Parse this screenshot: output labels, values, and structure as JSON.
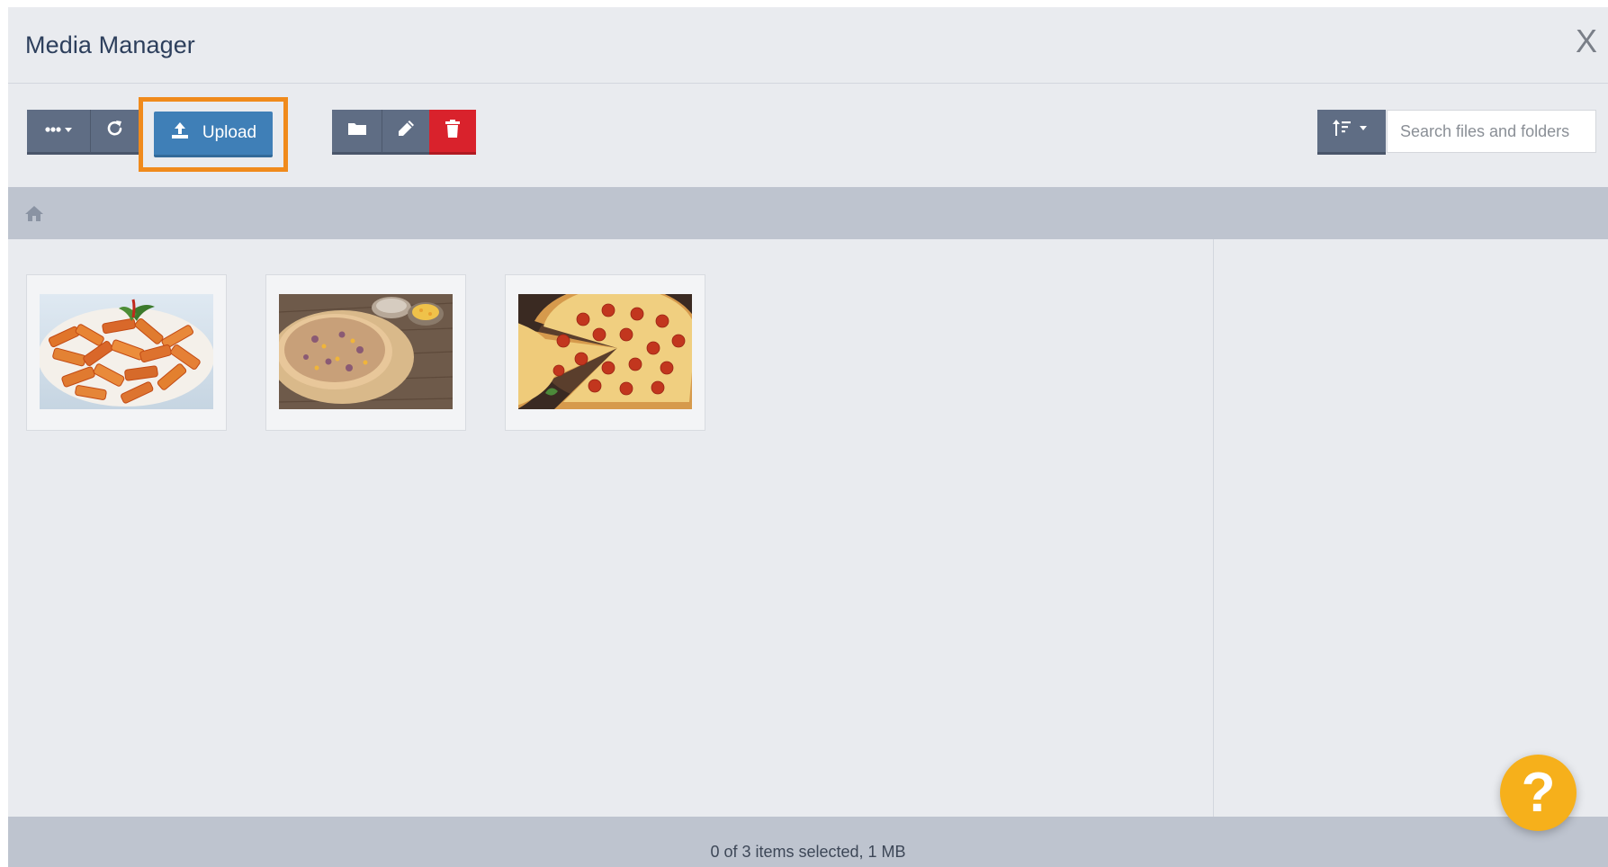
{
  "dialog": {
    "title": "Media Manager",
    "close_label": "X"
  },
  "toolbar": {
    "more_icon": "ellipsis-icon",
    "refresh_icon": "refresh-icon",
    "upload_label": "Upload",
    "upload_icon": "upload-icon",
    "folder_icon": "folder-icon",
    "edit_icon": "pencil-icon",
    "delete_icon": "trash-icon",
    "sort_icon": "sort-icon",
    "search_placeholder": "Search files and folders"
  },
  "breadcrumb": {
    "home_icon": "home-icon"
  },
  "files": [
    {
      "name": "penne-pasta",
      "type": "image"
    },
    {
      "name": "pizza-on-board",
      "type": "image"
    },
    {
      "name": "pepperoni-pizza",
      "type": "image"
    }
  ],
  "status": {
    "text": "0 of 3 items selected, 1 MB"
  },
  "help": {
    "label": "?"
  },
  "colors": {
    "background": "#e9ebef",
    "toolbar_button": "#5f6d84",
    "upload_button": "#3f7fb7",
    "delete_button": "#d9222c",
    "highlight": "#f08a1c",
    "help_button": "#f6b01b",
    "title_text": "#2d3f5c"
  }
}
